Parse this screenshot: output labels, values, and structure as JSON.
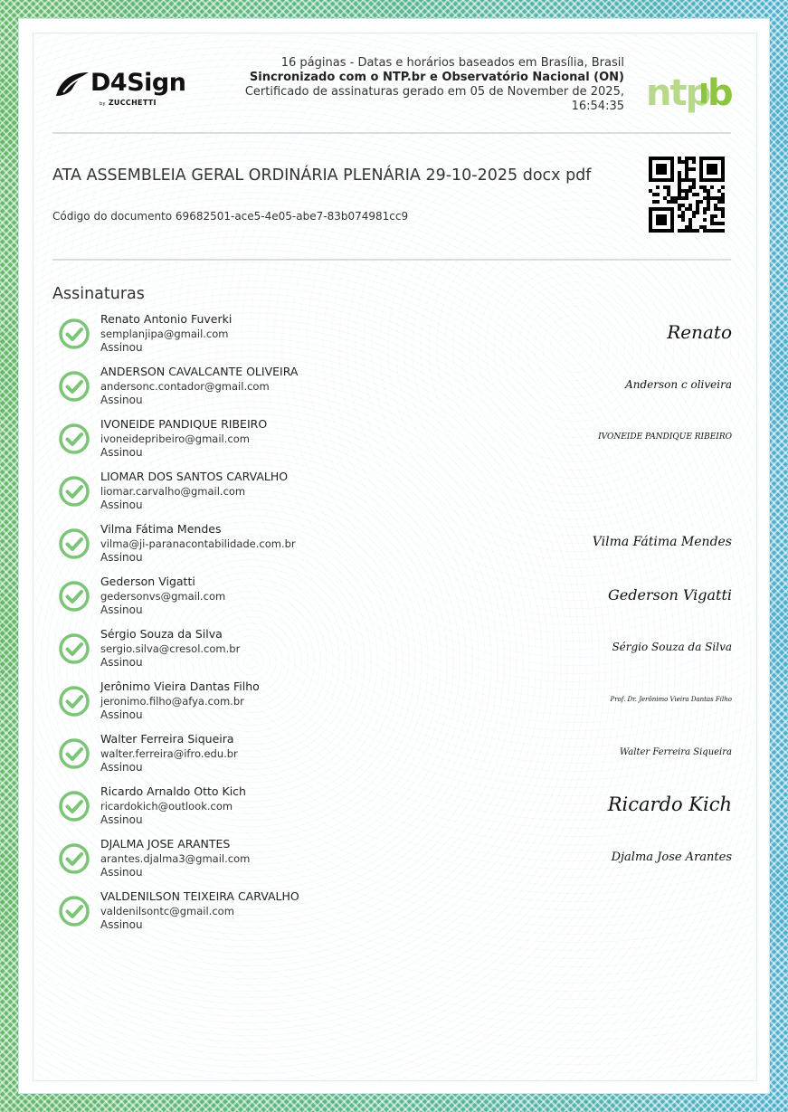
{
  "header": {
    "brand": "D4Sign",
    "brand_by": "by",
    "brand_sub": "ZUCCHETTI",
    "info_line1": "16 páginas - Datas e horários baseados em Brasília, Brasil",
    "info_line2": "Sincronizado com o NTP.br e Observatório Nacional (ON)",
    "info_line3": "Certificado de assinaturas gerado em 05 de November de 2025,",
    "info_line4": "16:54:35",
    "ntp_logo": "ntp.br",
    "colors": {
      "ntp_green": "#8cc63f",
      "check_green": "#7cc576"
    }
  },
  "document": {
    "title": "ATA ASSEMBLEIA GERAL ORDINÁRIA PLENÁRIA 29-10-2025 docx pdf",
    "code_label": "Código do documento 69682501-ace5-4e05-abe7-83b074981cc9"
  },
  "signatures_title": "Assinaturas",
  "signers": [
    {
      "name": "Renato Antonio Fuverki",
      "email": "semplanjipa@gmail.com",
      "status": "Assinou",
      "signature": "Renato"
    },
    {
      "name": "ANDERSON CAVALCANTE OLIVEIRA",
      "email": "andersonc.contador@gmail.com",
      "status": "Assinou",
      "signature": "Anderson c oliveira"
    },
    {
      "name": "IVONEIDE PANDIQUE RIBEIRO",
      "email": "ivoneidepribeiro@gmail.com",
      "status": "Assinou",
      "signature": "IVONEIDE PANDIQUE RIBEIRO"
    },
    {
      "name": "LIOMAR DOS SANTOS CARVALHO",
      "email": "liomar.carvalho@gmail.com",
      "status": "Assinou",
      "signature": ""
    },
    {
      "name": "Vilma Fátima Mendes",
      "email": "vilma@ji-paranacontabilidade.com.br",
      "status": "Assinou",
      "signature": "Vilma Fátima Mendes"
    },
    {
      "name": "Gederson Vigatti",
      "email": "gedersonvs@gmail.com",
      "status": "Assinou",
      "signature": "Gederson Vigatti"
    },
    {
      "name": "Sérgio Souza da Silva",
      "email": "sergio.silva@cresol.com.br",
      "status": "Assinou",
      "signature": "Sérgio Souza da Silva"
    },
    {
      "name": "Jerônimo Vieira Dantas Filho",
      "email": "jeronimo.filho@afya.com.br",
      "status": "Assinou",
      "signature": "Prof. Dr. Jerônimo Vieira Dantas Filho"
    },
    {
      "name": "Walter Ferreira Siqueira",
      "email": "walter.ferreira@ifro.edu.br",
      "status": "Assinou",
      "signature": "Walter Ferreira Siqueira"
    },
    {
      "name": "Ricardo Arnaldo Otto Kich",
      "email": "ricardokich@outlook.com",
      "status": "Assinou",
      "signature": "Ricardo Kich"
    },
    {
      "name": "DJALMA JOSE ARANTES",
      "email": "arantes.djalma3@gmail.com",
      "status": "Assinou",
      "signature": "Djalma Jose Arantes"
    },
    {
      "name": "VALDENILSON TEIXEIRA CARVALHO",
      "email": "valdenilsontc@gmail.com",
      "status": "Assinou",
      "signature": ""
    }
  ]
}
